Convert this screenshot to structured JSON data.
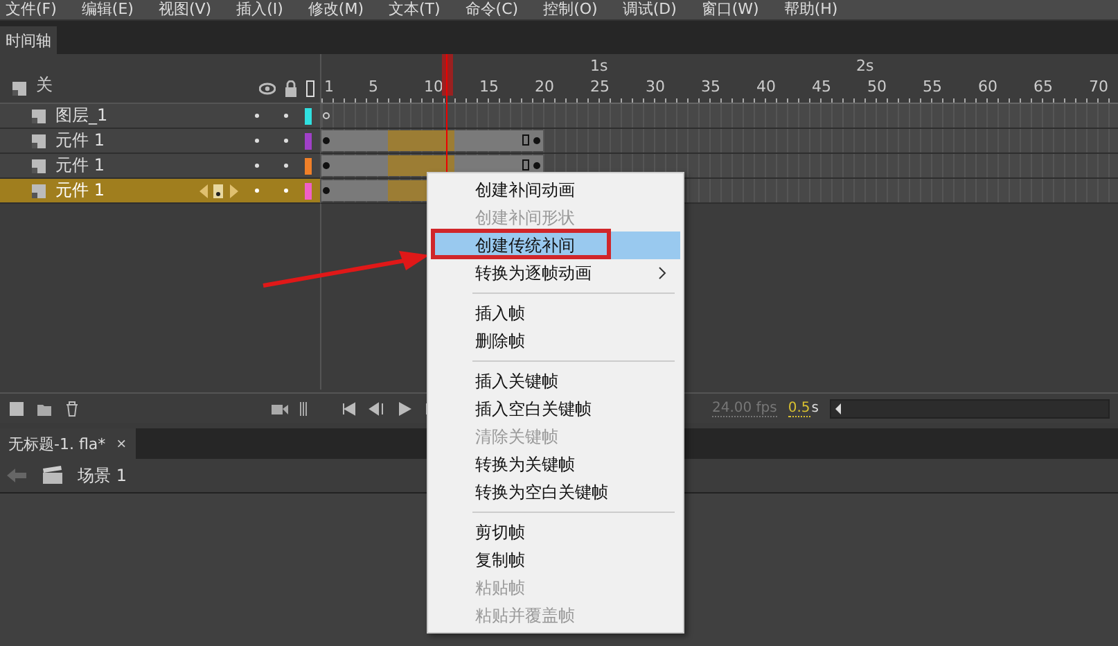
{
  "menu_bar": [
    "文件(F)",
    "编辑(E)",
    "视图(V)",
    "插入(I)",
    "修改(M)",
    "文本(T)",
    "命令(C)",
    "控制(O)",
    "调试(D)",
    "窗口(W)",
    "帮助(H)"
  ],
  "panel_tab": "时间轴",
  "timeline": {
    "header_label": "关",
    "ruler": {
      "second_labels": [
        "1s",
        "2s"
      ],
      "frame_numbers": [
        "1",
        "5",
        "10",
        "15",
        "20",
        "25",
        "30",
        "35",
        "40",
        "45",
        "50",
        "55",
        "60",
        "65",
        "70"
      ]
    },
    "layers": [
      {
        "name": "图层_1",
        "selected": false,
        "color": "#30e0e0",
        "kind": "empty"
      },
      {
        "name": "元件 1",
        "selected": false,
        "color": "#a040c8",
        "kind": "tween"
      },
      {
        "name": "元件 1",
        "selected": false,
        "color": "#f08028",
        "kind": "tween"
      },
      {
        "name": "元件 1",
        "selected": true,
        "color": "#f060c8",
        "kind": "tween"
      }
    ],
    "fps": "24.00 fps",
    "time": "0.5",
    "time_unit": "s"
  },
  "document_tab": {
    "title": "无标题-1. fla*",
    "close": "×"
  },
  "scene": "场景 1",
  "context_menu": [
    {
      "kind": "item",
      "label": "创建补间动画",
      "disabled": false,
      "selected": false
    },
    {
      "kind": "item",
      "label": "创建补间形状",
      "disabled": true,
      "selected": false
    },
    {
      "kind": "item",
      "label": "创建传统补间",
      "disabled": false,
      "selected": true
    },
    {
      "kind": "submenu",
      "label": "转换为逐帧动画",
      "disabled": false,
      "selected": false
    },
    {
      "kind": "separator"
    },
    {
      "kind": "item",
      "label": "插入帧",
      "disabled": false,
      "selected": false
    },
    {
      "kind": "item",
      "label": "删除帧",
      "disabled": false,
      "selected": false
    },
    {
      "kind": "separator"
    },
    {
      "kind": "item",
      "label": "插入关键帧",
      "disabled": false,
      "selected": false
    },
    {
      "kind": "item",
      "label": "插入空白关键帧",
      "disabled": false,
      "selected": false
    },
    {
      "kind": "item",
      "label": "清除关键帧",
      "disabled": true,
      "selected": false
    },
    {
      "kind": "item",
      "label": "转换为关键帧",
      "disabled": false,
      "selected": false
    },
    {
      "kind": "item",
      "label": "转换为空白关键帧",
      "disabled": false,
      "selected": false
    },
    {
      "kind": "separator"
    },
    {
      "kind": "item",
      "label": "剪切帧",
      "disabled": false,
      "selected": false
    },
    {
      "kind": "item",
      "label": "复制帧",
      "disabled": false,
      "selected": false
    },
    {
      "kind": "item",
      "label": "粘贴帧",
      "disabled": true,
      "selected": false
    },
    {
      "kind": "item",
      "label": "粘贴并覆盖帧",
      "disabled": true,
      "selected": false
    }
  ]
}
